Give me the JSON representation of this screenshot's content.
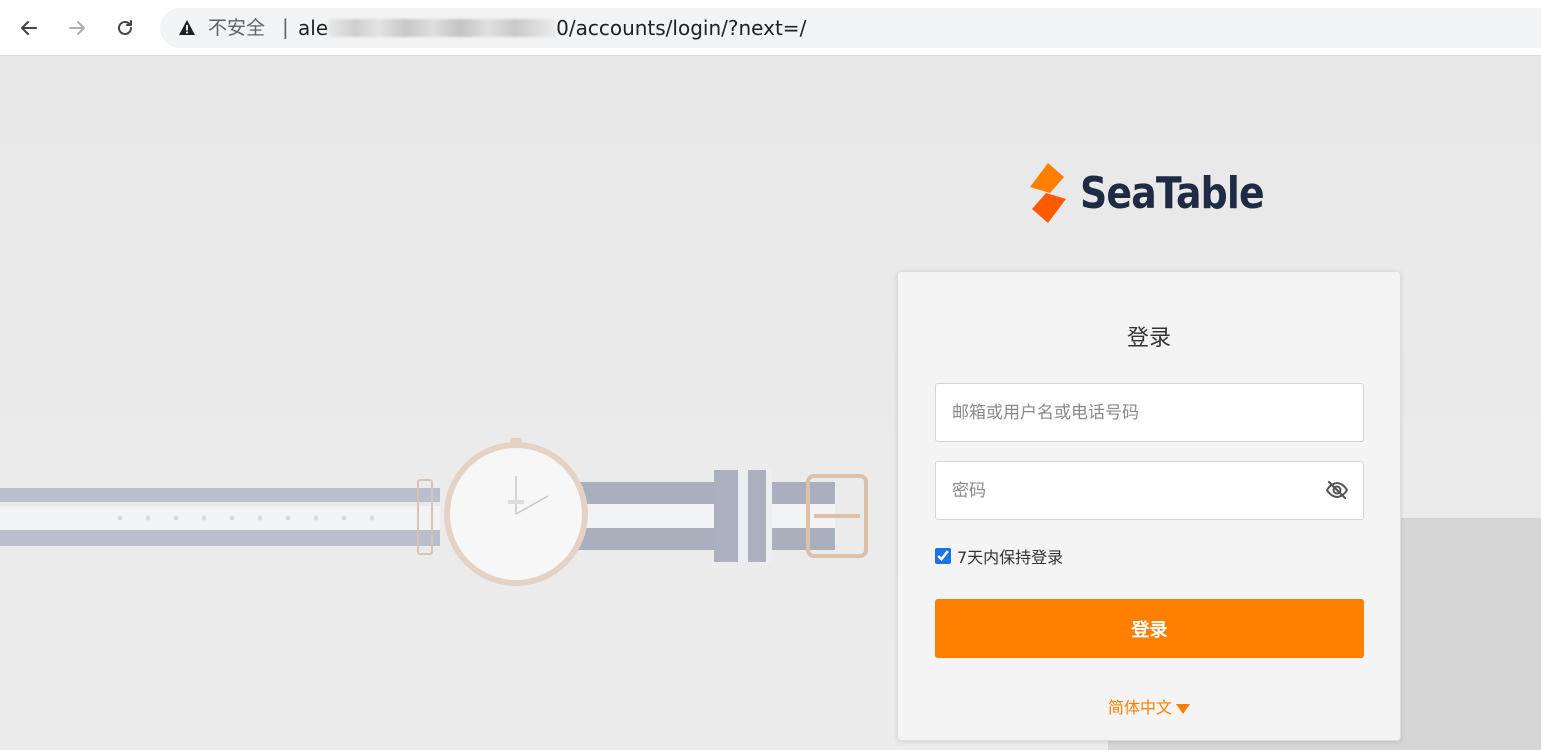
{
  "browser": {
    "security_label": "不安全",
    "separator": "|",
    "url_prefix": "ale",
    "url_suffix": "0/accounts/login/?next=/"
  },
  "brand": {
    "name": "SeaTable",
    "logo_colors": [
      "#ff8000",
      "#ff5a00"
    ],
    "text_color": "#1f2a44"
  },
  "login": {
    "title": "登录",
    "username_placeholder": "邮箱或用户名或电话号码",
    "password_placeholder": "密码",
    "remember_label": "7天内保持登录",
    "remember_checked": true,
    "submit_label": "登录",
    "language_label": "简体中文"
  },
  "colors": {
    "accent": "#ff8000"
  }
}
